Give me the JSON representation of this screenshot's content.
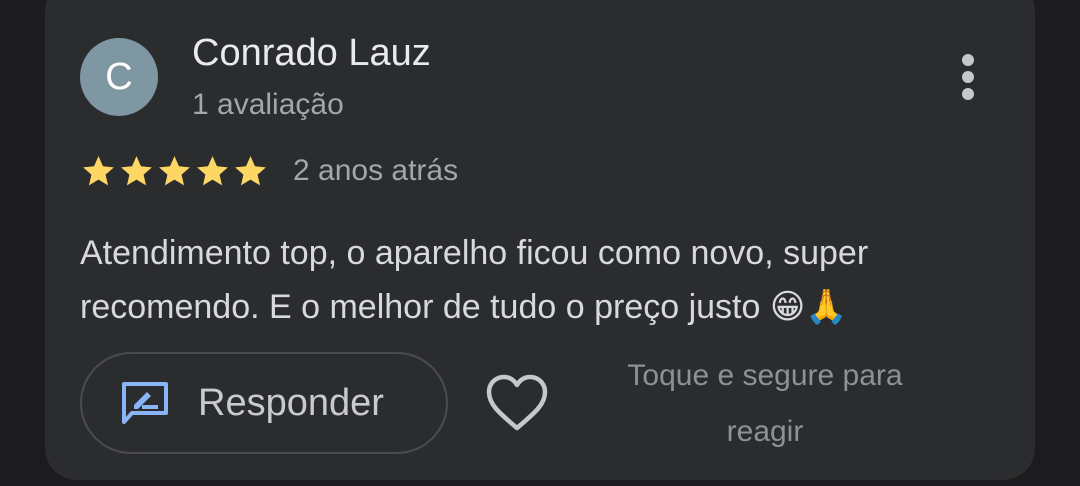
{
  "review": {
    "avatar_initial": "C",
    "author_name": "Conrado Lauz",
    "author_reviews": "1 avaliação",
    "rating": 5,
    "rating_max": 5,
    "time_ago": "2 anos atrás",
    "text": "Atendimento top, o aparelho ficou como novo, super recomendo. E o melhor de tudo o preço justo 😁🙏"
  },
  "actions": {
    "reply_label": "Responder",
    "react_hint": "Toque e segure para reagir"
  },
  "colors": {
    "card_bg": "#2b2c2e",
    "avatar_bg": "#7f97a3",
    "star": "#fdd663",
    "reply_icon": "#8ab4f8"
  },
  "icons": {
    "menu": "more-vert-icon",
    "reply": "reply-review-icon",
    "react": "heart-outline-icon",
    "rating": "star-icon"
  }
}
